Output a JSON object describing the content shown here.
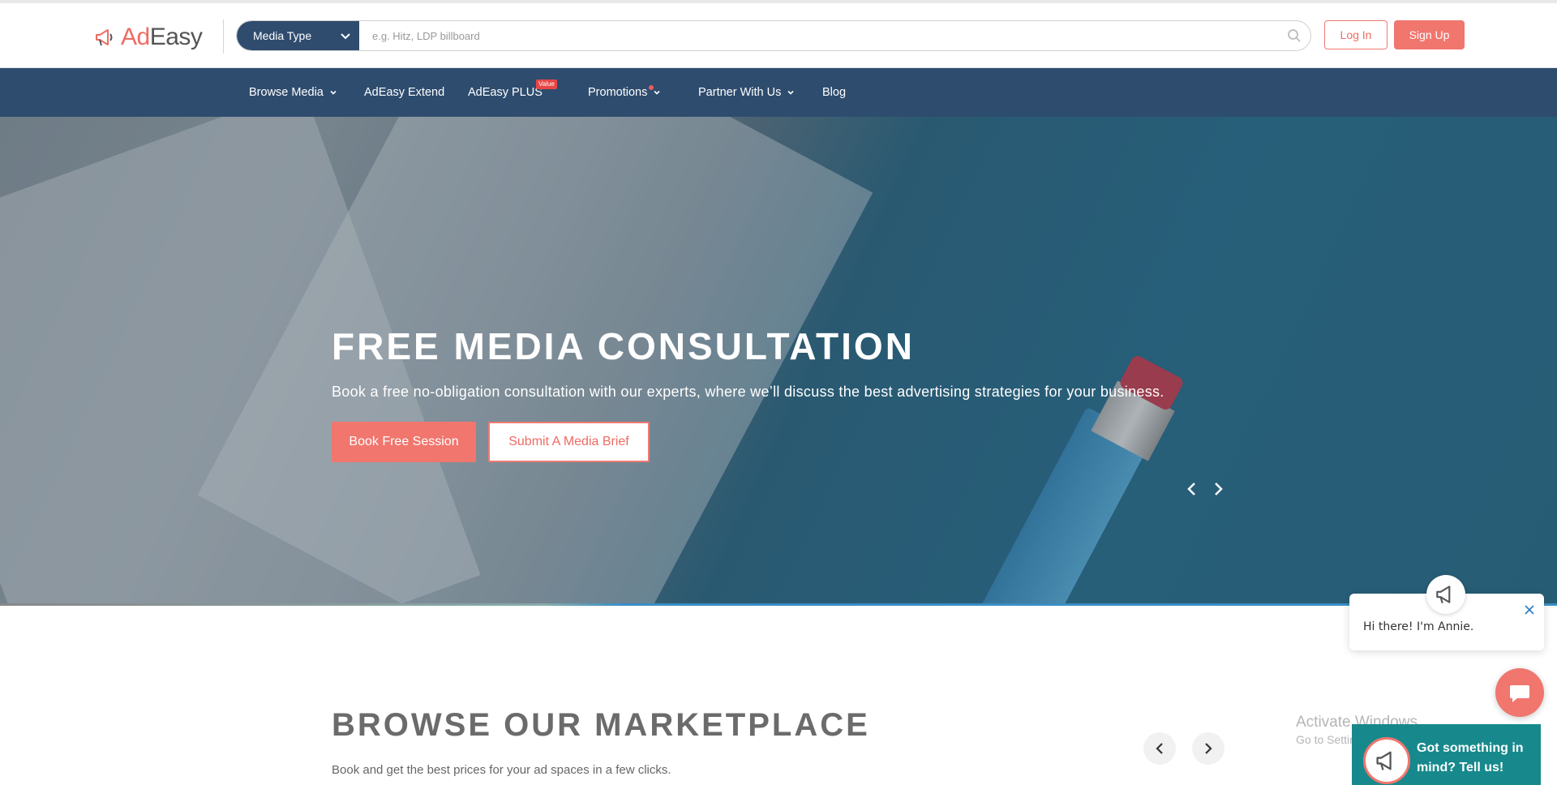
{
  "header": {
    "logo_ad": "Ad",
    "logo_easy": "Easy",
    "media_type_label": "Media Type",
    "search_placeholder": "e.g. Hitz, LDP billboard",
    "login_label": "Log In",
    "signup_label": "Sign Up"
  },
  "nav": {
    "items": [
      {
        "label": "Browse Media"
      },
      {
        "label": "AdEasy Extend"
      },
      {
        "label": "AdEasy PLUS",
        "badge": "Value"
      },
      {
        "label": "Promotions"
      },
      {
        "label": "Partner With Us"
      },
      {
        "label": "Blog"
      }
    ]
  },
  "hero": {
    "title": "FREE MEDIA CONSULTATION",
    "subtitle": "Book a free no-obligation consultation with our experts, where we’ll discuss the best advertising strategies for your business.",
    "book_label": "Book Free Session",
    "brief_label": "Submit A Media Brief"
  },
  "marketplace": {
    "title": "BROWSE OUR MARKETPLACE",
    "subtitle": "Book and get the best prices for your ad spaces in a few clicks."
  },
  "chat": {
    "greeting": "Hi there! I'm Annie.",
    "prompt": "Got something in mind? Tell us!"
  },
  "watermark": {
    "title": "Activate Windows",
    "subtitle": "Go to Settings to activate Windows."
  },
  "colors": {
    "brand_coral": "#f0766e",
    "nav_blue": "#2e4c6e",
    "teal": "#17898c"
  }
}
